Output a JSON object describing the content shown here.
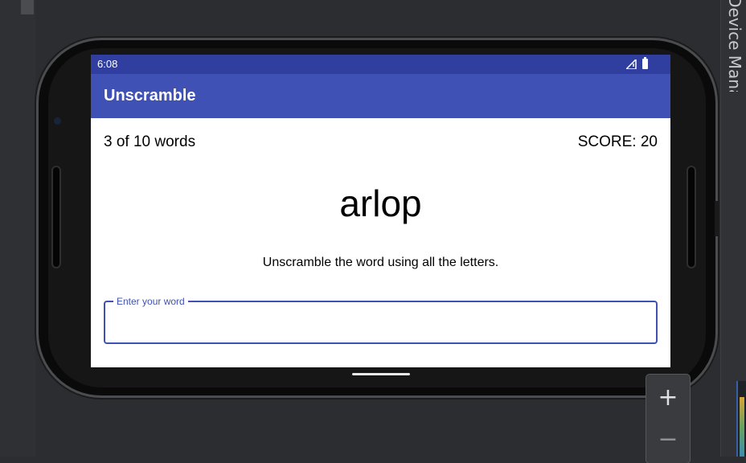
{
  "ide": {
    "side_panel_title": "Device Manager"
  },
  "status_bar": {
    "time": "6:08",
    "signal_icon": "signal-icon",
    "battery_icon": "battery-icon"
  },
  "app": {
    "title": "Unscramble",
    "word_count": "3 of 10 words",
    "score": "SCORE: 20",
    "scrambled_word": "arlop",
    "instructions": "Unscramble the word using all the letters.",
    "input": {
      "label": "Enter your word",
      "value": ""
    }
  },
  "zoom": {
    "in_label": "+",
    "out_label": "−"
  },
  "colors": {
    "status_bar": "#303f9f",
    "app_bar": "#3f51b5",
    "accent": "#3f51b5"
  }
}
